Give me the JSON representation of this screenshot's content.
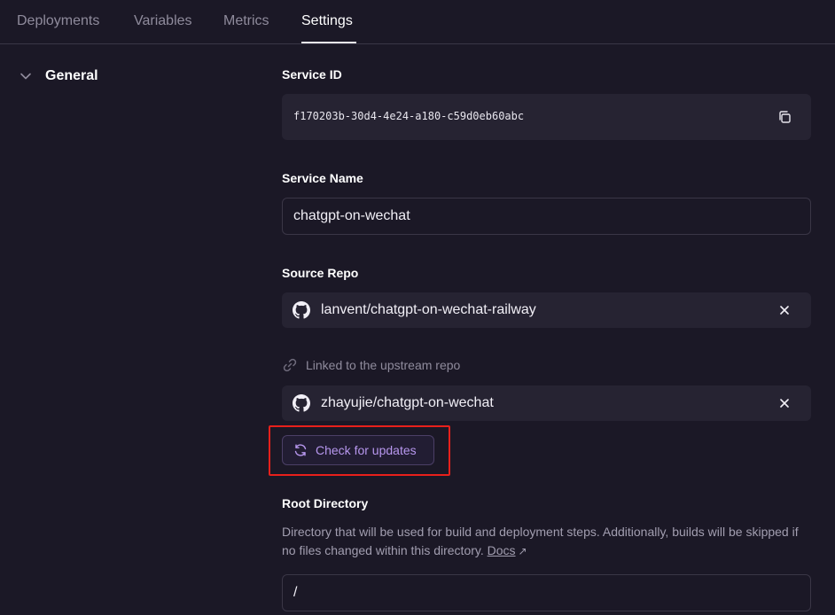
{
  "tabs": [
    {
      "label": "Deployments",
      "active": false
    },
    {
      "label": "Variables",
      "active": false
    },
    {
      "label": "Metrics",
      "active": false
    },
    {
      "label": "Settings",
      "active": true
    }
  ],
  "sidebar": {
    "section_label": "General",
    "section_icon": "chevron-down-icon"
  },
  "service_id": {
    "label": "Service ID",
    "value": "f170203b-30d4-4e24-a180-c59d0eb60abc",
    "icon": "copy-icon"
  },
  "service_name": {
    "label": "Service Name",
    "value": "chatgpt-on-wechat"
  },
  "source_repo": {
    "label": "Source Repo",
    "repo": "lanvent/chatgpt-on-wechat-railway",
    "linked_text": "Linked to the upstream repo",
    "upstream_repo": "zhayujie/chatgpt-on-wechat",
    "check_button": "Check for updates"
  },
  "root_directory": {
    "label": "Root Directory",
    "description": "Directory that will be used for build and deployment steps. Additionally, builds will be skipped if no files changed within this directory.",
    "docs_link": "Docs",
    "docs_icon": "↗",
    "value": "/"
  },
  "colors": {
    "background": "#1b1826",
    "field_bg": "#262332",
    "accent": "#b797ee",
    "highlight_border": "#e8201b"
  }
}
